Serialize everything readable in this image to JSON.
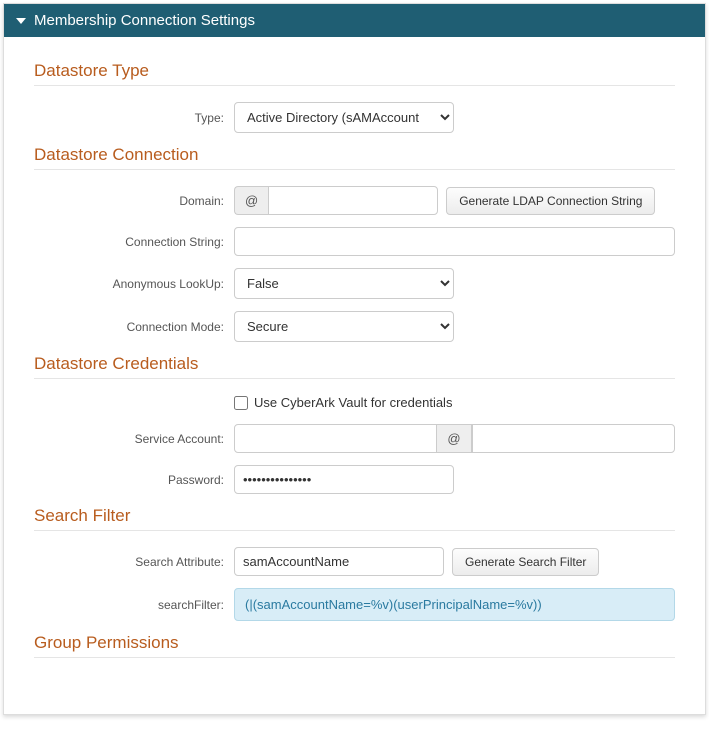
{
  "header": {
    "title": "Membership Connection Settings"
  },
  "sections": {
    "datastore_type": {
      "title": "Datastore Type",
      "type_label": "Type:",
      "type_value": "Active Directory (sAMAccount"
    },
    "datastore_connection": {
      "title": "Datastore Connection",
      "domain_label": "Domain:",
      "domain_prefix": "@",
      "domain_value": "",
      "generate_btn": "Generate LDAP Connection String",
      "connstr_label": "Connection String:",
      "connstr_value": "",
      "anon_label": "Anonymous LookUp:",
      "anon_value": "False",
      "mode_label": "Connection Mode:",
      "mode_value": "Secure"
    },
    "datastore_credentials": {
      "title": "Datastore Credentials",
      "cyberark_label": "Use CyberArk Vault for credentials",
      "svc_label": "Service Account:",
      "svc_value": "",
      "svc_at": "@",
      "svc_domain": "",
      "pwd_label": "Password:",
      "pwd_value": "•••••••••••••••"
    },
    "search_filter": {
      "title": "Search Filter",
      "attr_label": "Search Attribute:",
      "attr_value": "samAccountName",
      "generate_btn": "Generate Search Filter",
      "filter_label": "searchFilter:",
      "filter_value": "(|(samAccountName=%v)(userPrincipalName=%v))"
    },
    "group_permissions": {
      "title": "Group Permissions"
    }
  }
}
